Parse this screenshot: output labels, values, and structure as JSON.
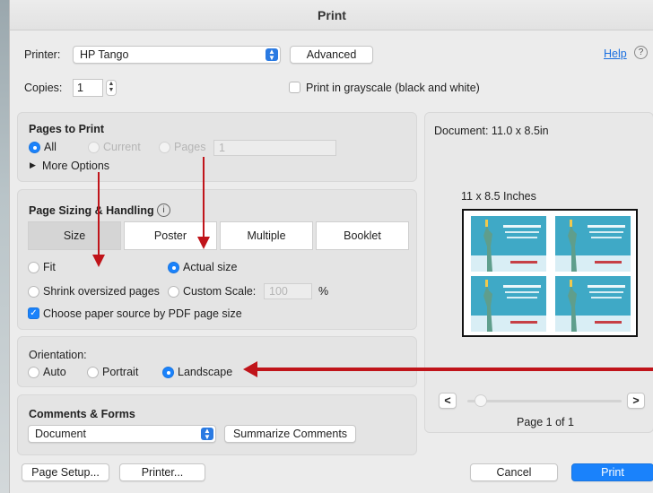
{
  "window": {
    "title": "Print"
  },
  "printer": {
    "label": "Printer:",
    "value": "HP Tango",
    "advanced_label": "Advanced",
    "help_label": "Help",
    "help_icon": "?"
  },
  "copies": {
    "label": "Copies:",
    "value": "1"
  },
  "grayscale": {
    "label": "Print in grayscale (black and white)",
    "checked": false
  },
  "pages_to_print": {
    "title": "Pages to Print",
    "all_label": "All",
    "current_label": "Current",
    "pages_label": "Pages",
    "pages_value": "1",
    "more_options_label": "More Options"
  },
  "sizing": {
    "title": "Page Sizing & Handling",
    "info_icon": "i",
    "tabs": [
      "Size",
      "Poster",
      "Multiple",
      "Booklet"
    ],
    "selected_tab": "Size",
    "fit_label": "Fit",
    "actual_size_label": "Actual size",
    "shrink_label": "Shrink oversized pages",
    "custom_scale_label": "Custom Scale:",
    "custom_scale_value": "100",
    "percent_label": "%",
    "paper_source_label": "Choose paper source by PDF page size"
  },
  "orientation": {
    "title": "Orientation:",
    "auto_label": "Auto",
    "portrait_label": "Portrait",
    "landscape_label": "Landscape",
    "selected": "Landscape"
  },
  "comments": {
    "title": "Comments & Forms",
    "value": "Document",
    "summarize_label": "Summarize Comments"
  },
  "preview": {
    "document_size": "Document: 11.0 x 8.5in",
    "paper_label": "11 x 8.5 Inches",
    "prev_label": "<",
    "next_label": ">",
    "page_indicator": "Page 1 of 1"
  },
  "footer": {
    "page_setup_label": "Page Setup...",
    "printer_label": "Printer...",
    "cancel_label": "Cancel",
    "print_label": "Print"
  },
  "colors": {
    "accent": "#1a82fb",
    "annotation_arrow": "#c0141a"
  }
}
